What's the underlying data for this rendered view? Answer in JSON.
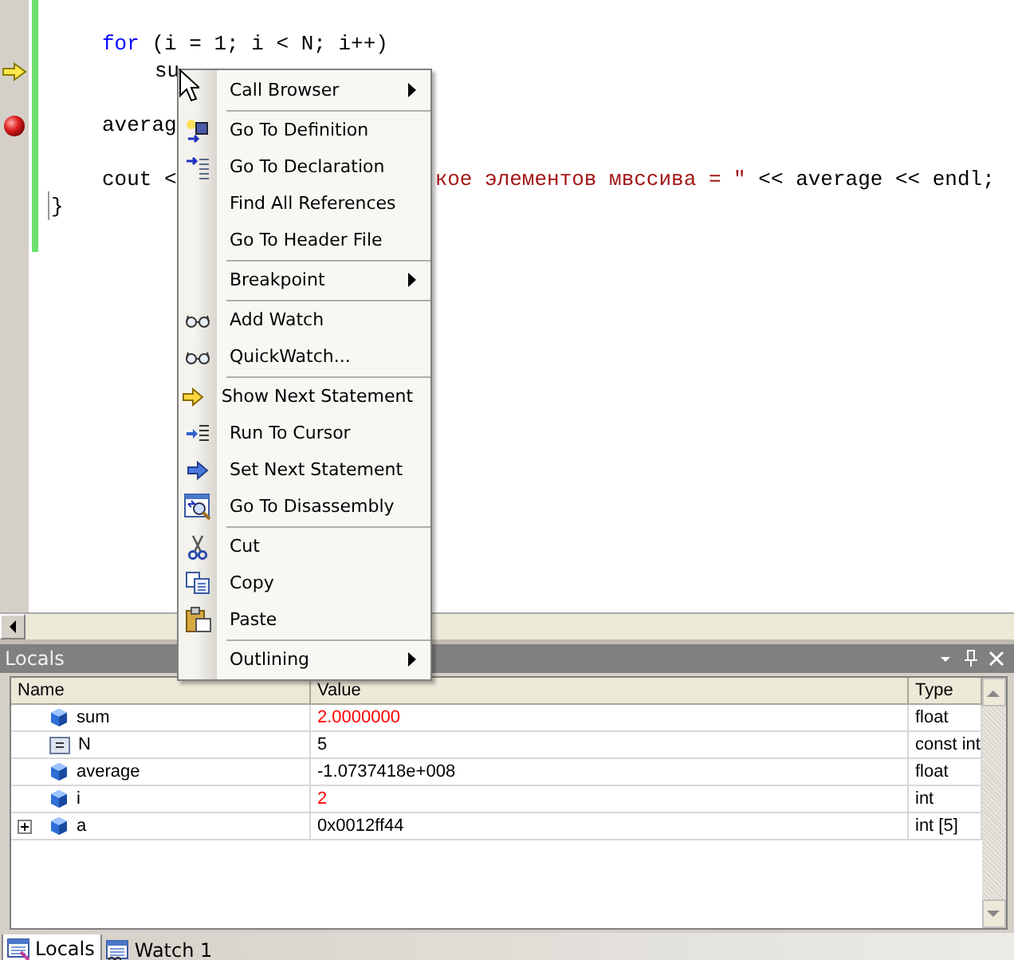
{
  "editor": {
    "lines": [
      {
        "current_statement": false,
        "breakpoint": false
      },
      {
        "current_statement": false,
        "breakpoint": false,
        "segments": [
          {
            "kind": "keyword",
            "text": "for"
          },
          {
            "kind": "plain",
            "text": " (i = 1; i < N; i++)"
          }
        ]
      },
      {
        "current_statement": true,
        "breakpoint": false,
        "segments": [
          {
            "kind": "plain",
            "text": "su"
          }
        ]
      },
      {
        "current_statement": false,
        "breakpoint": false
      },
      {
        "current_statement": false,
        "breakpoint": true,
        "segments": [
          {
            "kind": "plain",
            "text": "averag"
          }
        ]
      },
      {
        "current_statement": false,
        "breakpoint": false
      },
      {
        "current_statement": false,
        "breakpoint": false,
        "segments": [
          {
            "kind": "plain",
            "text": "cout <"
          },
          {
            "kind": "string",
            "text": "кое элементов мвссива = \""
          },
          {
            "kind": "plain",
            "text": " << average << endl;"
          }
        ]
      },
      {
        "current_statement": false,
        "breakpoint": false,
        "segments": [
          {
            "kind": "brace",
            "text": "}"
          }
        ]
      }
    ]
  },
  "context_menu": {
    "items": [
      {
        "kind": "item",
        "label": "Call Browser",
        "submenu": true
      },
      {
        "kind": "separator"
      },
      {
        "kind": "item",
        "label": "Go To Definition",
        "submenu": false
      },
      {
        "kind": "item",
        "label": "Go To Declaration",
        "submenu": false
      },
      {
        "kind": "item",
        "label": "Find All References",
        "submenu": false
      },
      {
        "kind": "item",
        "label": "Go To Header File",
        "submenu": false
      },
      {
        "kind": "separator"
      },
      {
        "kind": "item",
        "label": "Breakpoint",
        "submenu": true
      },
      {
        "kind": "separator"
      },
      {
        "kind": "item",
        "label": "Add Watch",
        "submenu": false
      },
      {
        "kind": "item",
        "label": "QuickWatch...",
        "submenu": false
      },
      {
        "kind": "separator"
      },
      {
        "kind": "item",
        "label": "Show Next Statement",
        "submenu": false
      },
      {
        "kind": "item",
        "label": "Run To Cursor",
        "submenu": false
      },
      {
        "kind": "item",
        "label": "Set Next Statement",
        "submenu": false
      },
      {
        "kind": "item",
        "label": "Go To Disassembly",
        "submenu": false
      },
      {
        "kind": "separator"
      },
      {
        "kind": "item",
        "label": "Cut",
        "submenu": false
      },
      {
        "kind": "item",
        "label": "Copy",
        "submenu": false
      },
      {
        "kind": "item",
        "label": "Paste",
        "submenu": false
      },
      {
        "kind": "separator"
      },
      {
        "kind": "item",
        "label": "Outlining",
        "submenu": true
      }
    ]
  },
  "locals": {
    "title": "Locals",
    "columns": [
      "Name",
      "Value",
      "Type"
    ],
    "rows": [
      {
        "kind": "variable",
        "name": "sum",
        "value": "2.0000000",
        "type": "float",
        "changed": true,
        "expandable": false
      },
      {
        "kind": "constant",
        "name": "N",
        "value": "5",
        "type": "const int",
        "changed": false,
        "expandable": false
      },
      {
        "kind": "variable",
        "name": "average",
        "value": "-1.0737418e+008",
        "type": "float",
        "changed": false,
        "expandable": false
      },
      {
        "kind": "variable",
        "name": "i",
        "value": "2",
        "type": "int",
        "changed": true,
        "expandable": false
      },
      {
        "kind": "variable",
        "name": "a",
        "value": "0x0012ff44",
        "type": "int [5]",
        "changed": false,
        "expandable": true
      }
    ]
  },
  "tabs": [
    {
      "label": "Locals",
      "selected": true
    },
    {
      "label": "Watch 1",
      "selected": false
    }
  ]
}
